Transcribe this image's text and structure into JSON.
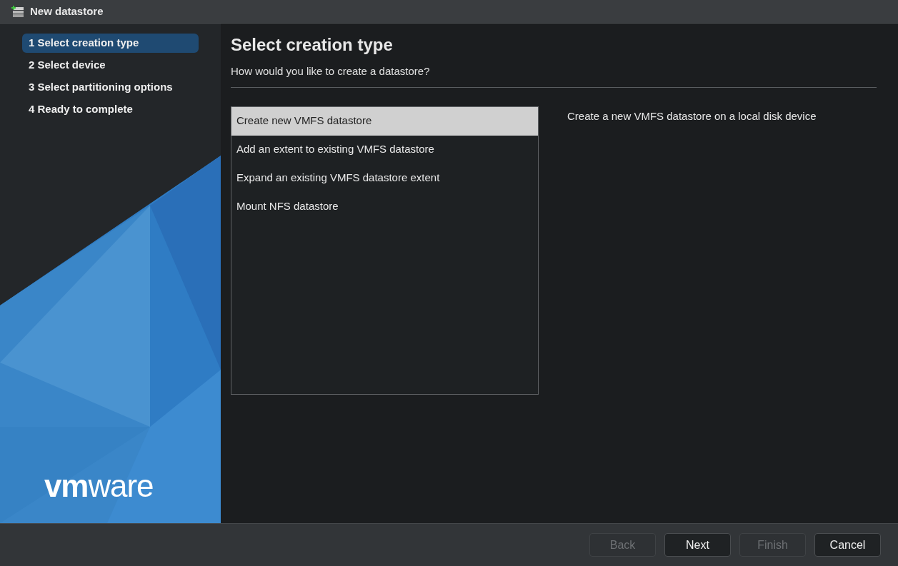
{
  "window": {
    "title": "New datastore"
  },
  "steps": [
    {
      "label": "1 Select creation type",
      "selected": true
    },
    {
      "label": "2 Select device",
      "selected": false
    },
    {
      "label": "3 Select partitioning options",
      "selected": false
    },
    {
      "label": "4 Ready to complete",
      "selected": false
    }
  ],
  "logo": {
    "text": "vmware"
  },
  "page": {
    "title": "Select creation type",
    "subtitle": "How would you like to create a datastore?"
  },
  "options": [
    {
      "label": "Create new VMFS datastore",
      "selected": true
    },
    {
      "label": "Add an extent to existing VMFS datastore",
      "selected": false
    },
    {
      "label": "Expand an existing VMFS datastore extent",
      "selected": false
    },
    {
      "label": "Mount NFS datastore",
      "selected": false
    }
  ],
  "description": "Create a new VMFS datastore on a local disk device",
  "buttons": [
    {
      "label": "Back",
      "disabled": true
    },
    {
      "label": "Next",
      "disabled": false
    },
    {
      "label": "Finish",
      "disabled": true
    },
    {
      "label": "Cancel",
      "disabled": false
    }
  ]
}
